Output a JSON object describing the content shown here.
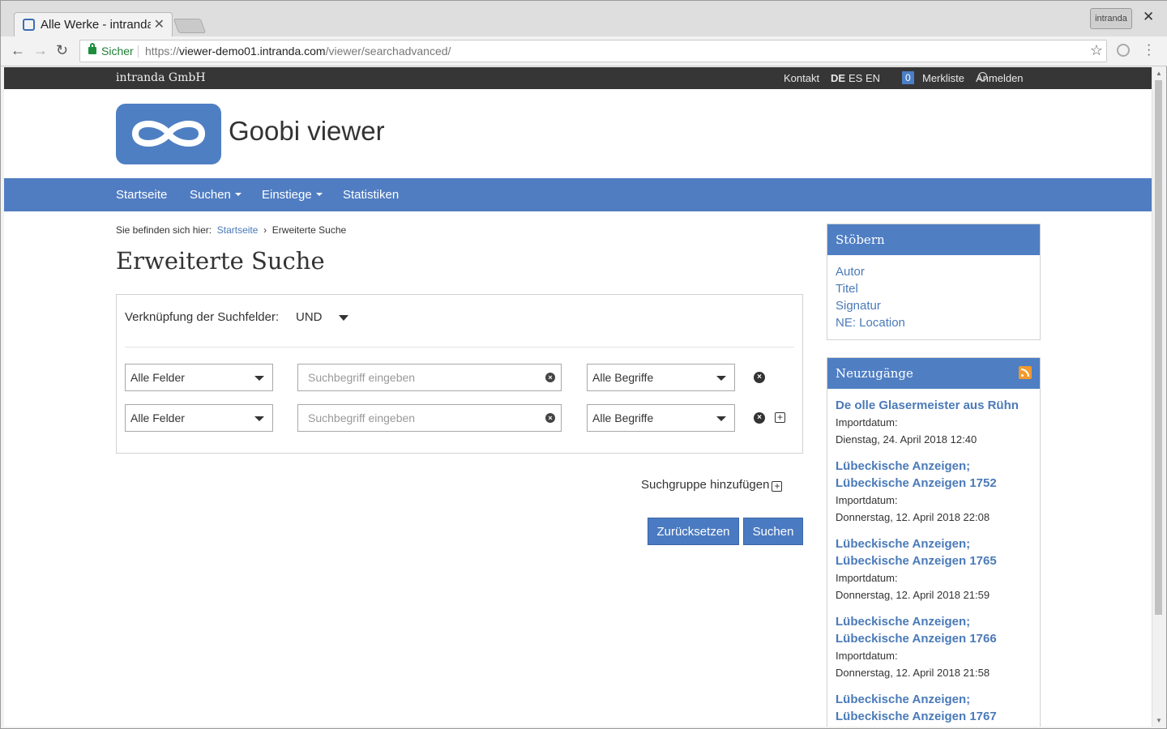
{
  "browser": {
    "tab_title": "Alle Werke - intranda",
    "profile_label": "intranda",
    "secure_label": "Sicher",
    "url_scheme": "https://",
    "url_host": "viewer-demo01.intranda.com",
    "url_path": "/viewer/searchadvanced/"
  },
  "topbar": {
    "org": "intranda GmbH",
    "contact": "Kontakt",
    "lang_de": "DE",
    "lang_es": "ES",
    "lang_en": "EN",
    "watchlist_count": "0",
    "watchlist": "Merkliste",
    "login": "Anmelden"
  },
  "header": {
    "logo_text": "Goobi viewer"
  },
  "nav": {
    "home": "Startseite",
    "search": "Suchen",
    "entries": "Einstiege",
    "stats": "Statistiken"
  },
  "breadcrumb": {
    "prefix": "Sie befinden sich hier:",
    "home": "Startseite",
    "sep": "›",
    "current": "Erweiterte Suche"
  },
  "page_title": "Erweiterte Suche",
  "search": {
    "link_label": "Verknüpfung der Suchfelder:",
    "link_value": "UND",
    "rows": [
      {
        "field": "Alle Felder",
        "placeholder": "Suchbegriff eingeben",
        "operator": "Alle Begriffe"
      },
      {
        "field": "Alle Felder",
        "placeholder": "Suchbegriff eingeben",
        "operator": "Alle Begriffe"
      }
    ],
    "add_group": "Suchgruppe hinzufügen",
    "reset": "Zurücksetzen",
    "submit": "Suchen"
  },
  "sidebar": {
    "browse_title": "Stöbern",
    "browse_items": [
      "Autor",
      "Titel",
      "Signatur",
      "NE: Location"
    ],
    "new_title": "Neuzugänge",
    "news": [
      {
        "title": "De olle Glasermeister aus Rühn",
        "label": "Importdatum:",
        "date": "Dienstag, 24. April 2018 12:40"
      },
      {
        "title": "Lübeckische Anzeigen; Lübeckische Anzeigen 1752",
        "label": "Importdatum:",
        "date": "Donnerstag, 12. April 2018 22:08"
      },
      {
        "title": "Lübeckische Anzeigen; Lübeckische Anzeigen 1765",
        "label": "Importdatum:",
        "date": "Donnerstag, 12. April 2018 21:59"
      },
      {
        "title": "Lübeckische Anzeigen; Lübeckische Anzeigen 1766",
        "label": "Importdatum:",
        "date": "Donnerstag, 12. April 2018 21:58"
      },
      {
        "title": "Lübeckische Anzeigen; Lübeckische Anzeigen 1767",
        "label": "",
        "date": ""
      }
    ]
  }
}
